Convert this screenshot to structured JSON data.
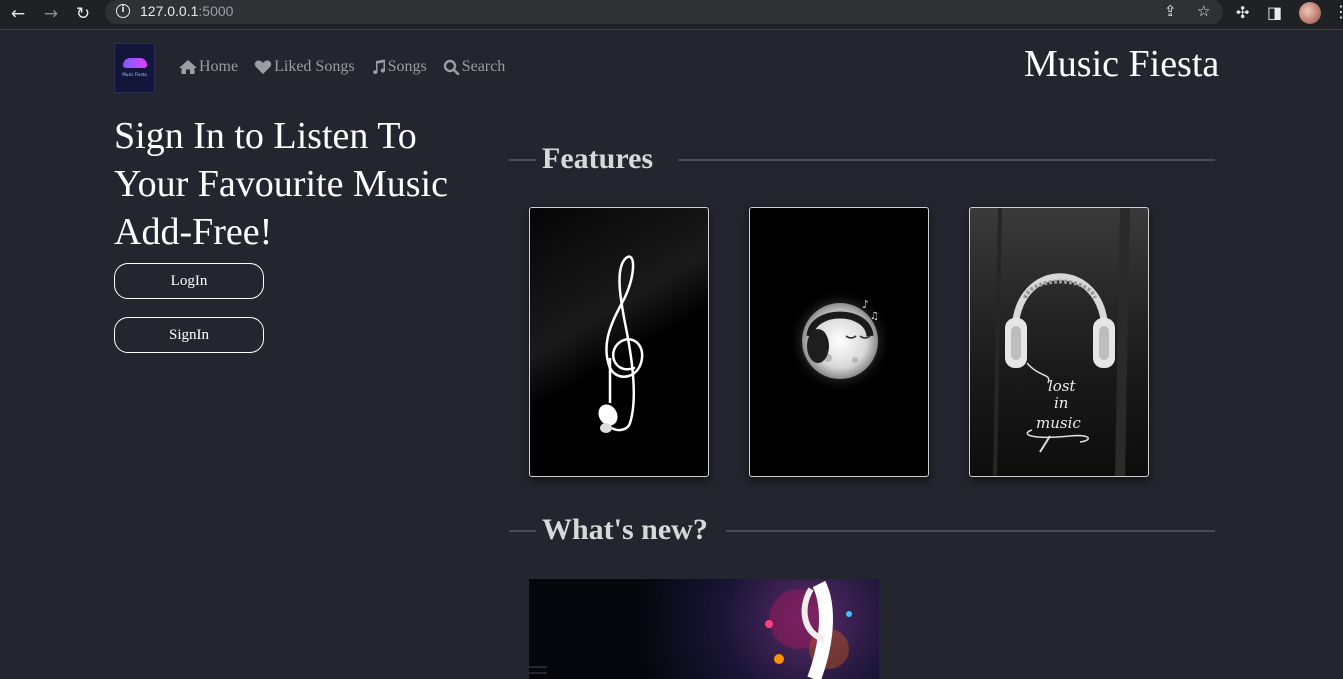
{
  "browser": {
    "url_host": "127.0.0.1",
    "url_port": ":5000"
  },
  "logo": {
    "text": "Music Fiesta"
  },
  "nav": {
    "items": [
      {
        "label": "Home",
        "icon": "home-icon"
      },
      {
        "label": "Liked Songs",
        "icon": "heart-icon"
      },
      {
        "label": "Songs",
        "icon": "music-note-icon"
      },
      {
        "label": "Search",
        "icon": "search-icon"
      }
    ],
    "brand": "Music Fiesta"
  },
  "hero": {
    "heading": "Sign In to Listen To Your Favourite Music Add-Free!",
    "login_label": "LogIn",
    "signin_label": "SignIn"
  },
  "features": {
    "title": "Features",
    "cards": [
      {
        "image": "treble-clef-earphones"
      },
      {
        "image": "moon-with-headphones"
      },
      {
        "image": "lost-in-music-headphones",
        "text": [
          "lost",
          "in",
          "music"
        ]
      }
    ]
  },
  "whats_new": {
    "title": "What's new?"
  },
  "colors": {
    "background": "#23262e",
    "heading": "#d8d8d8",
    "nav_text": "#9a9da3"
  }
}
